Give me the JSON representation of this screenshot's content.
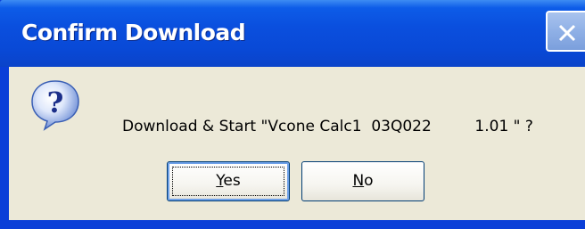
{
  "window": {
    "title": "Confirm Download"
  },
  "dialog": {
    "message": "Download & Start \"Vcone Calc1  03Q022         1.01 \" ?"
  },
  "buttons": {
    "yes_accel": "Y",
    "yes_rest": "es",
    "no_accel": "N",
    "no_rest": "o"
  },
  "icons": {
    "question": "question-icon",
    "close": "close-icon"
  },
  "colors": {
    "titlebar": "#0a4fde",
    "client": "#ece9d8",
    "close_button": "#8fb0e6"
  }
}
